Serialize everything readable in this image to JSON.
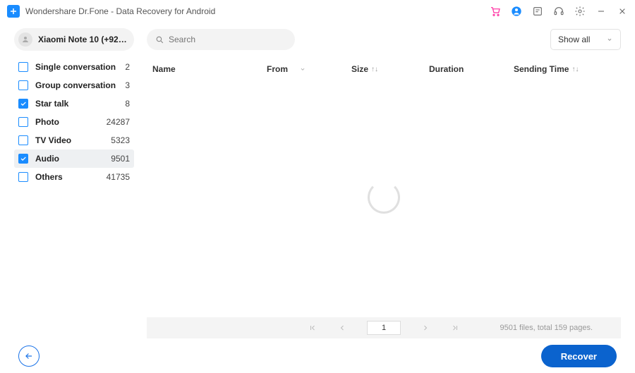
{
  "titlebar": {
    "title": "Wondershare Dr.Fone - Data Recovery for Android"
  },
  "sidebar": {
    "device": "Xiaomi Note 10 (+92315…",
    "items": [
      {
        "label": "Single conversation",
        "count": "2",
        "checked": false,
        "selected": false
      },
      {
        "label": "Group conversation",
        "count": "3",
        "checked": false,
        "selected": false
      },
      {
        "label": "Star talk",
        "count": "8",
        "checked": true,
        "selected": false
      },
      {
        "label": "Photo",
        "count": "24287",
        "checked": false,
        "selected": false
      },
      {
        "label": "TV Video",
        "count": "5323",
        "checked": false,
        "selected": false
      },
      {
        "label": "Audio",
        "count": "9501",
        "checked": true,
        "selected": true
      },
      {
        "label": "Others",
        "count": "41735",
        "checked": false,
        "selected": false
      }
    ]
  },
  "search": {
    "placeholder": "Search"
  },
  "showall": {
    "label": "Show all"
  },
  "columns": {
    "name": "Name",
    "from": "From",
    "size": "Size",
    "duration": "Duration",
    "sending": "Sending Time"
  },
  "pager": {
    "page": "1",
    "status": "9501 files, total 159 pages."
  },
  "footer": {
    "recover": "Recover"
  }
}
